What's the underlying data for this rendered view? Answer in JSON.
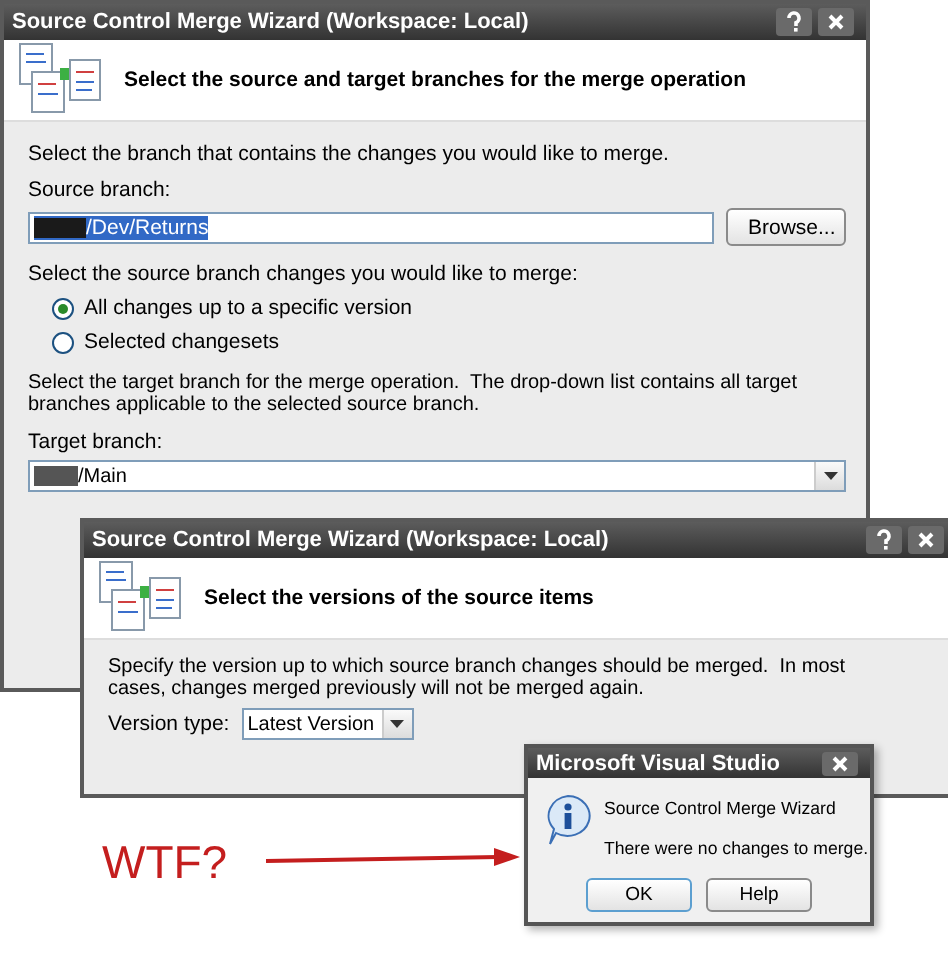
{
  "branches_wizard": {
    "title": "Source Control Merge Wizard (Workspace: Local)",
    "heading": "Select the source and target branches for the merge operation",
    "intro": "Select the branch that contains the changes you would like to merge.",
    "source_label": "Source branch:",
    "source_value": "/Dev/Returns",
    "browse_button": "Browse...",
    "changes_label": "Select the source branch changes you would like to merge:",
    "options": [
      {
        "label": "All changes up to a specific version",
        "selected": true
      },
      {
        "label": "Selected changesets",
        "selected": false
      }
    ],
    "target_text": "Select the target branch for the merge operation.  The drop-down list contains all target branches applicable to the selected source branch.",
    "target_label": "Target branch:",
    "target_value": "/Main"
  },
  "versions_wizard": {
    "title": "Source Control Merge Wizard (Workspace: Local)",
    "heading": "Select the versions of the source items",
    "intro": "Specify the version up to which source branch changes should be merged.  In most cases, changes merged previously will not be merged again.",
    "version_label": "Version type:",
    "version_value": "Latest Version"
  },
  "message_box": {
    "title": "Microsoft Visual Studio",
    "caption": "Source Control Merge Wizard",
    "message": "There were no changes to merge.",
    "buttons": [
      "OK",
      "Help"
    ]
  },
  "annotation": {
    "text": "WTF?"
  }
}
